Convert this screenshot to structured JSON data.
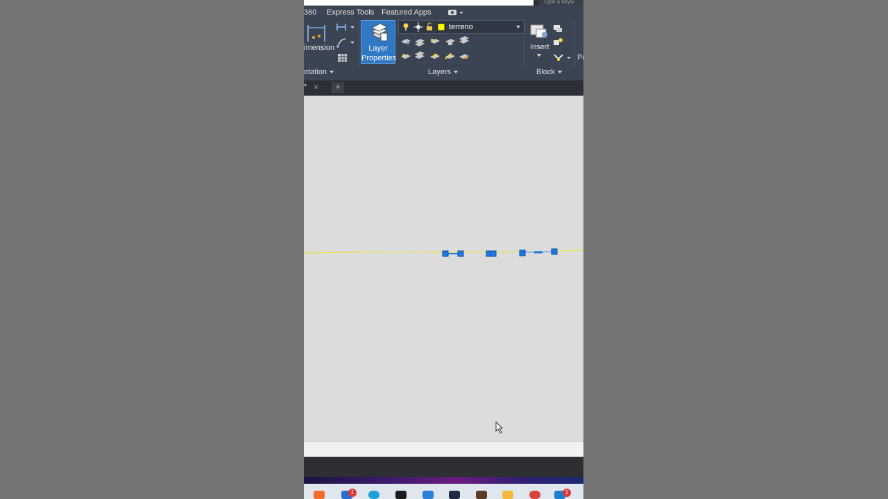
{
  "search": {
    "placeholder": "Type a keyw"
  },
  "ribbon": {
    "tabs": [
      "360",
      "Express Tools",
      "Featured Apps"
    ],
    "annotation_panel": {
      "dimension_label": "imension",
      "footer_label": "otation"
    },
    "layers_panel": {
      "layer_properties_line1": "Layer",
      "layer_properties_line2": "Properties",
      "current_layer": "terreno",
      "current_layer_color": "#ffff00",
      "footer_label": "Layers"
    },
    "block_panel": {
      "insert_label": "Insert",
      "footer_label": "Block",
      "cut_label": "Pr"
    }
  },
  "doc_tabs": {
    "close_symbol": "×",
    "active_tab_fragment": "*",
    "new_tab_symbol": "+"
  },
  "taskbar": {
    "badges": [
      "1",
      "1"
    ]
  },
  "colors": {
    "accent": "#1f6fd1",
    "grip": "#1f78e0",
    "yellow_line": "#e8e34a"
  }
}
